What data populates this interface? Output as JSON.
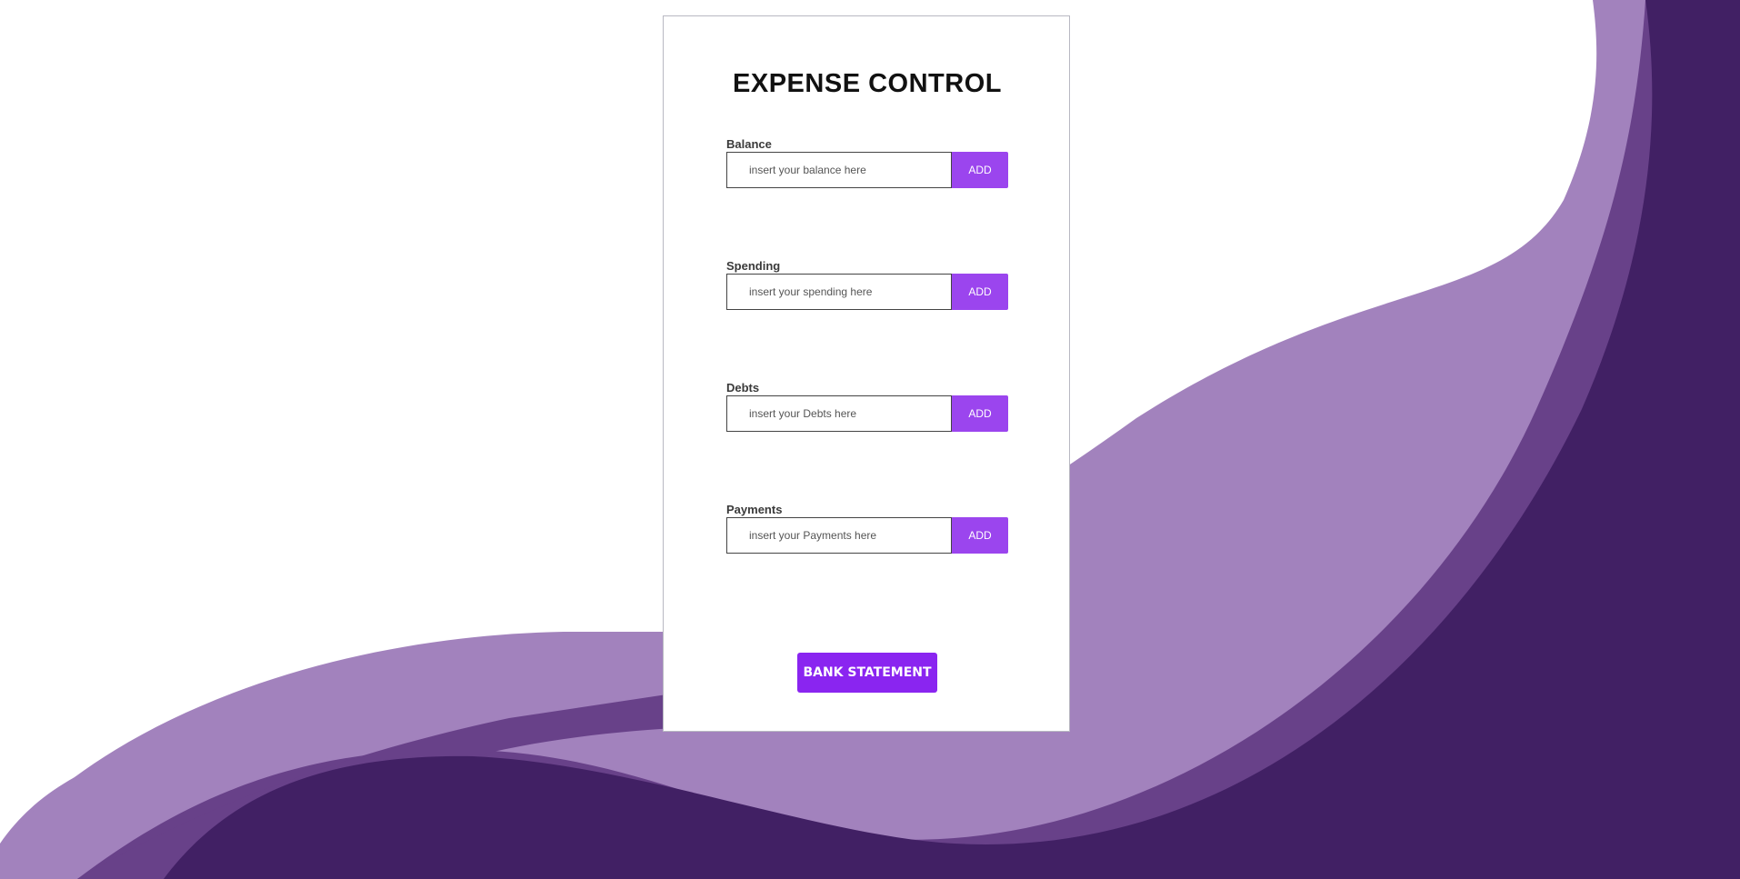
{
  "app": {
    "title": "EXPENSE CONTROL"
  },
  "fields": [
    {
      "label": "Balance",
      "placeholder": "insert your balance here",
      "value": "",
      "button_label": "ADD"
    },
    {
      "label": "Spending",
      "placeholder": "insert your spending here",
      "value": "",
      "button_label": "ADD"
    },
    {
      "label": "Debts",
      "placeholder": "insert your Debts here",
      "value": "",
      "button_label": "ADD"
    },
    {
      "label": "Payments",
      "placeholder": "insert your Payments here",
      "value": "",
      "button_label": "ADD"
    }
  ],
  "actions": {
    "statement_label": "BANK STATEMENT"
  },
  "colors": {
    "accent": "#9b45ee",
    "primary_button": "#8a25f0",
    "wave_light": "#a282bd",
    "wave_mid": "#684189",
    "wave_dark": "#412064"
  }
}
